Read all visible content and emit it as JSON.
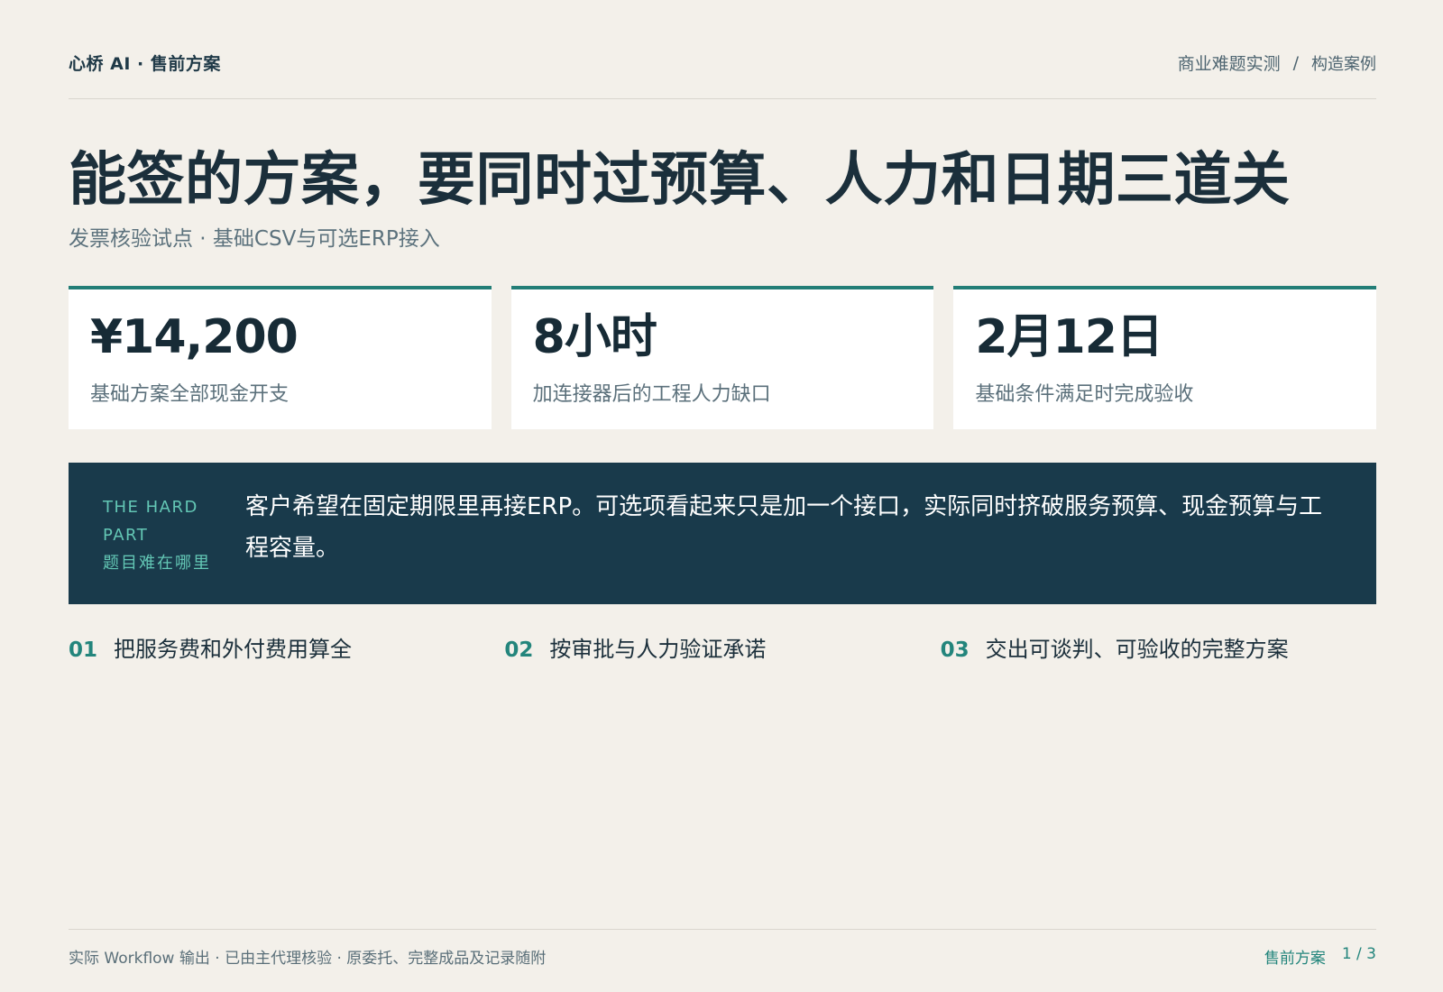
{
  "header": {
    "brand": "心桥 AI · 售前方案",
    "breadcrumb_1": "商业难题实测",
    "breadcrumb_sep": "/",
    "breadcrumb_2": "构造案例"
  },
  "title": "能签的方案，要同时过预算、人力和日期三道关",
  "subtitle": "发票核验试点 · 基础CSV与可选ERP接入",
  "metrics": [
    {
      "value": "¥14,200",
      "label": "基础方案全部现金开支"
    },
    {
      "value": "8小时",
      "label": "加连接器后的工程人力缺口"
    },
    {
      "value": "2月12日",
      "label": "基础条件满足时完成验收"
    }
  ],
  "callout": {
    "tag_en": "THE HARD PART",
    "tag_zh": "题目难在哪里",
    "text": "客户希望在固定期限里再接ERP。可选项看起来只是加一个接口，实际同时挤破服务预算、现金预算与工程容量。"
  },
  "steps": [
    {
      "num": "01",
      "text": "把服务费和外付费用算全"
    },
    {
      "num": "02",
      "text": "按审批与人力验证承诺"
    },
    {
      "num": "03",
      "text": "交出可谈判、可验收的完整方案"
    }
  ],
  "footer": {
    "note": "实际 Workflow 输出 · 已由主代理核验 · 原委托、完整成品及记录随附",
    "section": "售前方案",
    "page": "1 / 3"
  },
  "colors": {
    "background": "#f3f0ea",
    "accent": "#237e77",
    "band": "#193a4b",
    "tag": "#63c7b5"
  }
}
